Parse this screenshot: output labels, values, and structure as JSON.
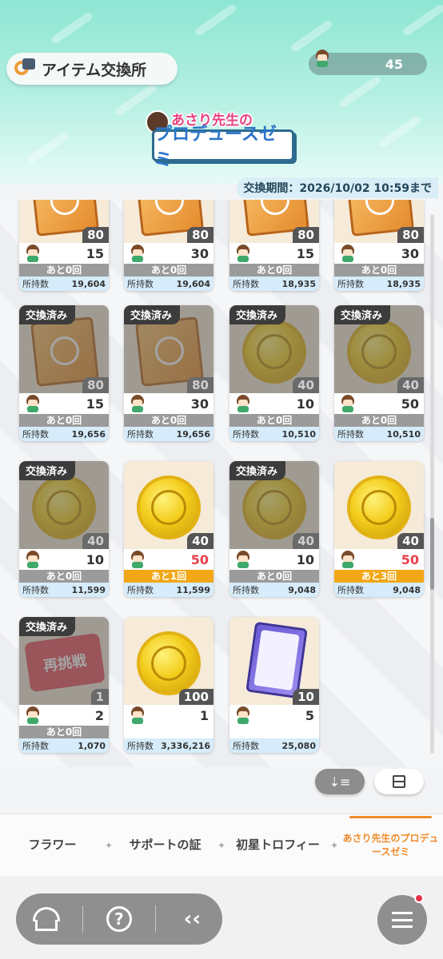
{
  "header": {
    "title": "アイテム交換所",
    "currency_count": "45",
    "banner_subtitle": "あさり先生の",
    "banner_title": "プロデュースゼミ",
    "period": "交換期間：2026/10/02 10:59まで"
  },
  "labels": {
    "exchanged": "交換済み",
    "owned": "所持数"
  },
  "items": [
    {
      "kind": "book",
      "done": false,
      "qty": "80",
      "cost": "15",
      "remain": "あと0回",
      "owned": "19,604",
      "partial": true
    },
    {
      "kind": "book",
      "done": false,
      "qty": "80",
      "cost": "30",
      "remain": "あと0回",
      "owned": "19,604",
      "partial": true
    },
    {
      "kind": "book",
      "done": false,
      "qty": "80",
      "cost": "15",
      "remain": "あと0回",
      "owned": "18,935",
      "partial": true
    },
    {
      "kind": "book",
      "done": false,
      "qty": "80",
      "cost": "30",
      "remain": "あと0回",
      "owned": "18,935",
      "partial": true
    },
    {
      "kind": "book",
      "done": true,
      "qty": "80",
      "cost": "15",
      "remain": "あと0回",
      "owned": "19,656"
    },
    {
      "kind": "book",
      "done": true,
      "qty": "80",
      "cost": "30",
      "remain": "あと0回",
      "owned": "19,656"
    },
    {
      "kind": "coin",
      "done": true,
      "qty": "40",
      "cost": "10",
      "remain": "あと0回",
      "owned": "10,510"
    },
    {
      "kind": "coin",
      "done": true,
      "qty": "40",
      "cost": "50",
      "remain": "あと0回",
      "owned": "10,510"
    },
    {
      "kind": "coin",
      "done": true,
      "qty": "40",
      "cost": "10",
      "remain": "あと0回",
      "owned": "11,599"
    },
    {
      "kind": "coin",
      "done": false,
      "qty": "40",
      "cost": "50",
      "remain": "あと1回",
      "owned": "11,599",
      "avail": true,
      "costRed": true
    },
    {
      "kind": "coin",
      "done": true,
      "qty": "40",
      "cost": "10",
      "remain": "あと0回",
      "owned": "9,048"
    },
    {
      "kind": "coin",
      "done": false,
      "qty": "40",
      "cost": "50",
      "remain": "あと3回",
      "owned": "9,048",
      "avail": true,
      "costRed": true
    },
    {
      "kind": "ticket",
      "done": true,
      "qty": "1",
      "cost": "2",
      "remain": "あと0回",
      "owned": "1,070",
      "ticketText": "再挑戦"
    },
    {
      "kind": "coin",
      "done": false,
      "qty": "100",
      "cost": "1",
      "remain": "",
      "owned": "3,336,216"
    },
    {
      "kind": "cardpack",
      "done": false,
      "qty": "10",
      "cost": "5",
      "remain": "",
      "owned": "25,080"
    }
  ],
  "tabs": [
    "フラワー",
    "サポートの証",
    "初星トロフィー",
    "あさり先生のプロデュースゼミ"
  ],
  "tab_separator": "✦",
  "colors": {
    "accent": "#f08a2a",
    "header": "#8ee6d3",
    "red": "#e8414b",
    "available": "#f2a716"
  },
  "icons": [
    "exchange-icon",
    "home-icon",
    "help-icon",
    "back-icon",
    "menu-icon",
    "sort-icon",
    "view-toggle-icon"
  ]
}
